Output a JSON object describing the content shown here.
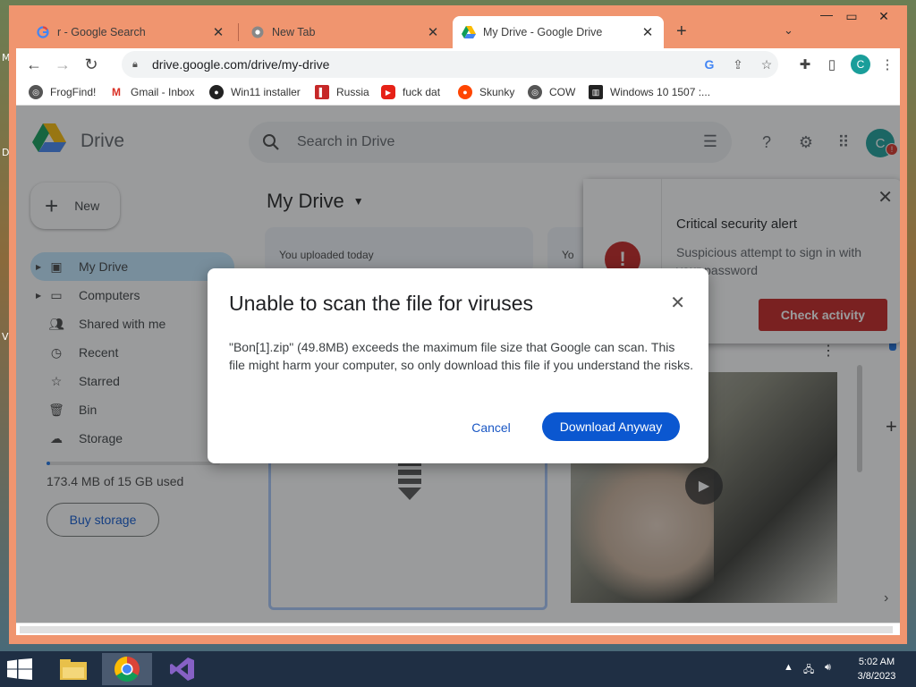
{
  "browser": {
    "tabs": [
      {
        "title": "r - Google Search",
        "favicon": "google-g-icon"
      },
      {
        "title": "New Tab",
        "favicon": "chrome-icon"
      },
      {
        "title": "My Drive - Google Drive",
        "favicon": "drive-icon",
        "active": true
      }
    ],
    "url": "drive.google.com/drive/my-drive",
    "profile_initial": "C",
    "bookmarks": [
      {
        "label": "FrogFind!",
        "icon": "globe-icon"
      },
      {
        "label": "Gmail - Inbox",
        "icon": "gmail-icon"
      },
      {
        "label": "Win11 installer",
        "icon": "github-icon"
      },
      {
        "label": "Russia",
        "icon": "flag-icon"
      },
      {
        "label": "fuck dat",
        "icon": "youtube-icon"
      },
      {
        "label": "Skunky",
        "icon": "reddit-icon"
      },
      {
        "label": "COW",
        "icon": "globe-icon"
      },
      {
        "label": "Windows 10 1507 :...",
        "icon": "archive-icon"
      }
    ]
  },
  "drive": {
    "app_name": "Drive",
    "search_placeholder": "Search in Drive",
    "avatar_initial": "C",
    "avatar_badge": "!",
    "new_label": "New",
    "nav": [
      {
        "label": "My Drive",
        "icon": "my-drive-icon",
        "selected": true
      },
      {
        "label": "Computers",
        "icon": "computers-icon"
      },
      {
        "label": "Shared with me",
        "icon": "shared-icon"
      },
      {
        "label": "Recent",
        "icon": "clock-icon"
      },
      {
        "label": "Starred",
        "icon": "star-icon"
      },
      {
        "label": "Bin",
        "icon": "trash-icon"
      },
      {
        "label": "Storage",
        "icon": "cloud-icon"
      }
    ],
    "storage_used_text": "173.4 MB of 15 GB used",
    "storage_used_fraction": 0.012,
    "buy_storage": "Buy storage",
    "page_title": "My Drive",
    "suggested": [
      {
        "label": "You uploaded today"
      },
      {
        "label": "Yo"
      }
    ]
  },
  "alert": {
    "title": "Critical security alert",
    "text": "Suspicious attempt to sign in with your password",
    "button": "Check activity"
  },
  "modal": {
    "title": "Unable to scan the file for viruses",
    "body": "\"Bon[1].zip\" (49.8MB) exceeds the maximum file size that Google can scan. This file might harm your computer, so only download this file if you understand the risks.",
    "cancel": "Cancel",
    "download": "Download Anyway"
  },
  "taskbar": {
    "time": "5:02 AM",
    "date": "3/8/2023"
  },
  "desktop_letters": [
    "M",
    "D",
    "V"
  ],
  "colors": {
    "window_frame": "#f0956f",
    "accent": "#0b57d0",
    "alert_red": "#c5221f"
  }
}
